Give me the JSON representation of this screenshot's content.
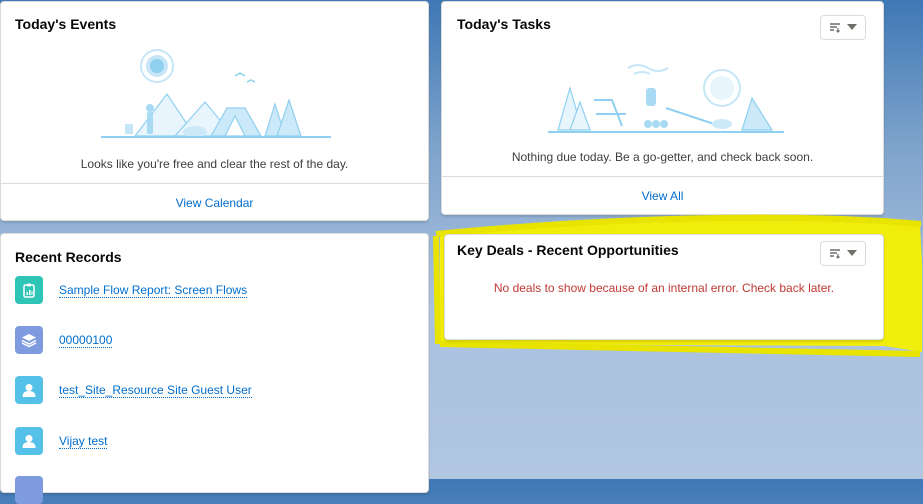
{
  "events": {
    "title": "Today's Events",
    "empty_message": "Looks like you're free and clear the rest of the day.",
    "footer_link": "View Calendar"
  },
  "tasks": {
    "title": "Today's Tasks",
    "empty_message": "Nothing due today. Be a go-getter, and check back soon.",
    "footer_link": "View All"
  },
  "recent_records": {
    "title": "Recent Records",
    "items": [
      {
        "label": "Sample Flow Report: Screen Flows",
        "icon": "report-icon",
        "color": "#2ec4b6"
      },
      {
        "label": "00000100",
        "icon": "stack-icon",
        "color": "#7f9be0"
      },
      {
        "label": "test_Site_Resource Site Guest User",
        "icon": "user-icon",
        "color": "#56c1e8"
      },
      {
        "label": "Vijay test",
        "icon": "user-icon",
        "color": "#56c1e8"
      }
    ]
  },
  "key_deals": {
    "title": "Key Deals - Recent Opportunities",
    "error_message": "No deals to show because of an internal error. Check back later."
  },
  "colors": {
    "link": "#006dcc",
    "error": "#c23934",
    "highlight": "#f4f000",
    "illustration": "#8fd0f0"
  }
}
